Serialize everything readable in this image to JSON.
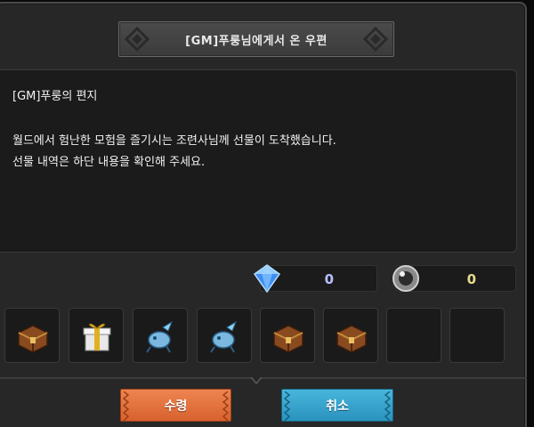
{
  "dialog": {
    "title": "[GM]푸룽님에게서 온 우편"
  },
  "letter": {
    "title": "[GM]푸룽의 편지",
    "line1": "월드에서 험난한 모험을 즐기시는 조련사님께 선물이 도착했습니다.",
    "line2": "선물 내역은 하단 내용을 확인해 주세요."
  },
  "currencies": [
    {
      "icon": "gem-icon",
      "value": "0",
      "color": "#b8c0ff"
    },
    {
      "icon": "stone-icon",
      "value": "0",
      "color": "#e6dc8a"
    }
  ],
  "reward_slots": [
    {
      "icon": "treasure-chest-icon"
    },
    {
      "icon": "gift-box-icon"
    },
    {
      "icon": "blue-egg-icon"
    },
    {
      "icon": "blue-egg-icon"
    },
    {
      "icon": "treasure-chest-icon"
    },
    {
      "icon": "treasure-chest-icon"
    },
    {
      "icon": "empty-slot"
    },
    {
      "icon": "empty-slot"
    }
  ],
  "buttons": {
    "receive_label": "수령",
    "cancel_label": "취소"
  },
  "colors": {
    "receive_button": "#e2703a",
    "cancel_button": "#3aa6d0",
    "panel": "#272727"
  }
}
